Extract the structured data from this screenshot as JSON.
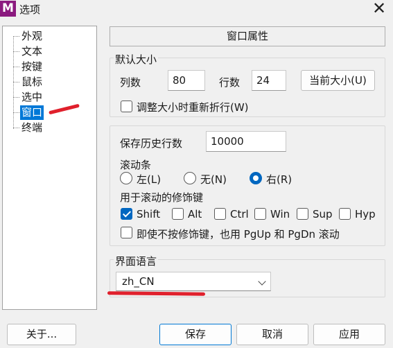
{
  "window": {
    "title": "选项",
    "app_icon_letter": "M"
  },
  "tree": {
    "items": [
      {
        "label": "外观"
      },
      {
        "label": "文本"
      },
      {
        "label": "按键"
      },
      {
        "label": "鼠标"
      },
      {
        "label": "选中"
      },
      {
        "label": "窗口",
        "selected": true
      },
      {
        "label": "终端"
      }
    ]
  },
  "panel": {
    "header": "窗口属性",
    "default_size": {
      "title": "默认大小",
      "columns_label": "列数",
      "columns_value": "80",
      "rows_label": "行数",
      "rows_value": "24",
      "current_size_button": "当前大小(U)",
      "rewrap_label": "调整大小时重新折行(W)",
      "rewrap_checked": false
    },
    "scroll": {
      "history_label": "保存历史行数",
      "history_value": "10000",
      "scrollbar_label": "滚动条",
      "scrollbar_options": [
        {
          "label": "左(L)",
          "checked": false
        },
        {
          "label": "无(N)",
          "checked": false
        },
        {
          "label": "右(R)",
          "checked": true
        }
      ],
      "modifier_label": "用于滚动的修饰键",
      "modifiers": [
        {
          "label": "Shift",
          "checked": true
        },
        {
          "label": "Alt",
          "checked": false
        },
        {
          "label": "Ctrl",
          "checked": false
        },
        {
          "label": "Win",
          "checked": false
        },
        {
          "label": "Sup",
          "checked": false
        },
        {
          "label": "Hyp",
          "checked": false
        }
      ],
      "pgupdn_label": "即使不按修饰键，也用 PgUp 和 PgDn 滚动",
      "pgupdn_checked": false
    },
    "language": {
      "title": "界面语言",
      "selected": "zh_CN"
    }
  },
  "footer": {
    "about_button": "关于...",
    "save_button": "保存",
    "cancel_button": "取消",
    "apply_button": "应用"
  },
  "colors": {
    "accent": "#0067c0",
    "selection": "#0078d7",
    "annotation_red": "#e0202c",
    "app_icon": "#8b1a7f"
  }
}
